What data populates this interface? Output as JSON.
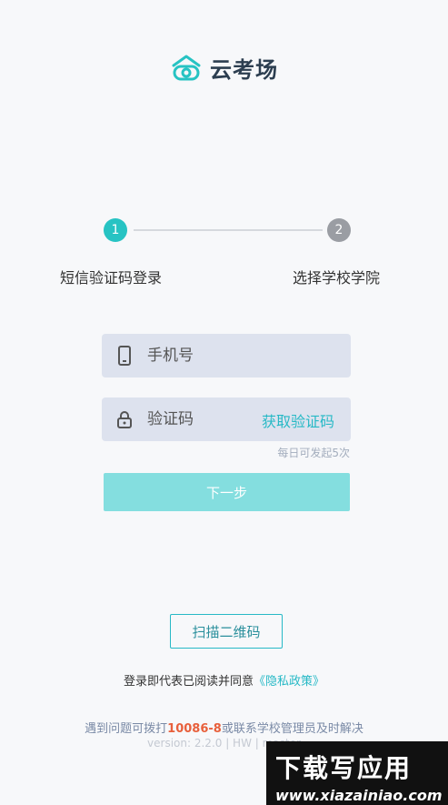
{
  "app": {
    "name": "云考场",
    "brand_color": "#27c3c3"
  },
  "steps": [
    {
      "number": "1",
      "label": "短信验证码登录",
      "active": true
    },
    {
      "number": "2",
      "label": "选择学校学院",
      "active": false
    }
  ],
  "form": {
    "phone": {
      "placeholder": "手机号",
      "icon": "phone-icon"
    },
    "code": {
      "placeholder": "验证码",
      "icon": "lock-icon",
      "get_code_label": "获取验证码"
    },
    "limit_note": "每日可发起5次",
    "next_label": "下一步"
  },
  "scan_label": "扫描二维码",
  "agreement": {
    "prefix": "登录即代表已阅读并同意",
    "link": "《隐私政策》"
  },
  "help": {
    "prefix": "遇到问题可拨打",
    "phone": "10086-8",
    "suffix": "或联系学校管理员及时解决"
  },
  "version": "version: 2.2.0 | HW | master",
  "watermark": {
    "title": "下载写应用",
    "url": "www.xiazainiao.com"
  }
}
